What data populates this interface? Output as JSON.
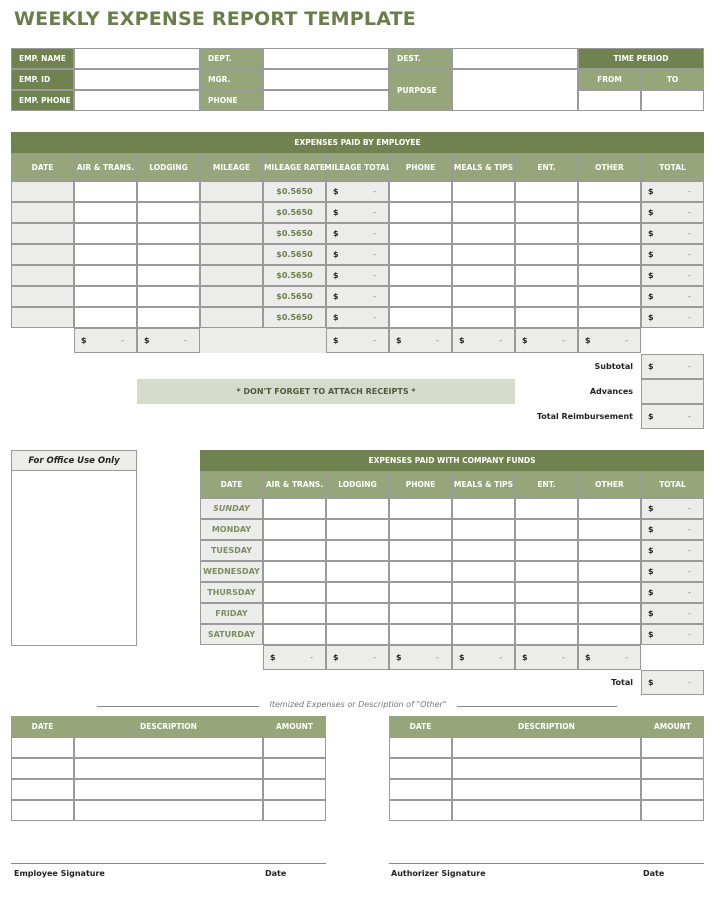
{
  "title": "WEEKLY EXPENSE REPORT TEMPLATE",
  "header": {
    "emp_name_label": "EMP. NAME",
    "emp_id_label": "EMP. ID",
    "emp_phone_label": "EMP. PHONE",
    "dept_label": "DEPT.",
    "mgr_label": "MGR.",
    "phone_label": "PHONE",
    "dest_label": "DEST.",
    "purpose_label": "PURPOSE",
    "time_period_label": "TIME PERIOD",
    "from_label": "FROM",
    "to_label": "TO",
    "emp_name": "",
    "emp_id": "",
    "emp_phone": "",
    "dept": "",
    "mgr": "",
    "phone": "",
    "dest": "",
    "purpose": "",
    "from": "",
    "to": ""
  },
  "employee_expenses": {
    "title": "EXPENSES PAID BY EMPLOYEE",
    "columns": [
      "DATE",
      "AIR & TRANS.",
      "LODGING",
      "MILEAGE",
      "MILEAGE RATE",
      "MILEAGE TOTAL",
      "PHONE",
      "MEALS & TIPS",
      "ENT.",
      "OTHER",
      "TOTAL"
    ],
    "rows": [
      {
        "mileage_rate": "$0.5650",
        "mileage_total": {
          "cur": "$",
          "val": "-"
        },
        "total": {
          "cur": "$",
          "val": "-"
        }
      },
      {
        "mileage_rate": "$0.5650",
        "mileage_total": {
          "cur": "$",
          "val": "-"
        },
        "total": {
          "cur": "$",
          "val": "-"
        }
      },
      {
        "mileage_rate": "$0.5650",
        "mileage_total": {
          "cur": "$",
          "val": "-"
        },
        "total": {
          "cur": "$",
          "val": "-"
        }
      },
      {
        "mileage_rate": "$0.5650",
        "mileage_total": {
          "cur": "$",
          "val": "-"
        },
        "total": {
          "cur": "$",
          "val": "-"
        }
      },
      {
        "mileage_rate": "$0.5650",
        "mileage_total": {
          "cur": "$",
          "val": "-"
        },
        "total": {
          "cur": "$",
          "val": "-"
        }
      },
      {
        "mileage_rate": "$0.5650",
        "mileage_total": {
          "cur": "$",
          "val": "-"
        },
        "total": {
          "cur": "$",
          "val": "-"
        }
      },
      {
        "mileage_rate": "$0.5650",
        "mileage_total": {
          "cur": "$",
          "val": "-"
        },
        "total": {
          "cur": "$",
          "val": "-"
        }
      }
    ],
    "column_totals": {
      "air_trans": {
        "cur": "$",
        "val": "-"
      },
      "lodging": {
        "cur": "$",
        "val": "-"
      },
      "mileage_total": {
        "cur": "$",
        "val": "-"
      },
      "phone": {
        "cur": "$",
        "val": "-"
      },
      "meals_tips": {
        "cur": "$",
        "val": "-"
      },
      "ent": {
        "cur": "$",
        "val": "-"
      },
      "other": {
        "cur": "$",
        "val": "-"
      }
    },
    "receipt_note": "* DON'T FORGET TO ATTACH RECEIPTS *",
    "subtotal_label": "Subtotal",
    "subtotal": {
      "cur": "$",
      "val": "-"
    },
    "advances_label": "Advances",
    "advances": "",
    "total_reimbursement_label": "Total Reimbursement",
    "total_reimbursement": {
      "cur": "$",
      "val": "-"
    }
  },
  "office_use": {
    "label": "For Office Use Only"
  },
  "company_expenses": {
    "title": "EXPENSES PAID WITH COMPANY FUNDS",
    "columns": [
      "DATE",
      "AIR & TRANS.",
      "LODGING",
      "PHONE",
      "MEALS & TIPS",
      "ENT.",
      "OTHER",
      "TOTAL"
    ],
    "days": [
      "SUNDAY",
      "MONDAY",
      "TUESDAY",
      "WEDNESDAY",
      "THURSDAY",
      "FRIDAY",
      "SATURDAY"
    ],
    "row_total": {
      "cur": "$",
      "val": "-"
    },
    "column_total": {
      "cur": "$",
      "val": "-"
    },
    "total_label": "Total",
    "total": {
      "cur": "$",
      "val": "-"
    }
  },
  "itemized": {
    "caption": "Itemized Expenses or Description of \"Other\"",
    "columns": [
      "DATE",
      "DESCRIPTION",
      "AMOUNT"
    ]
  },
  "signatures": {
    "employee_label": "Employee Signature",
    "employee_date_label": "Date",
    "authorizer_label": "Authorizer Signature",
    "authorizer_date_label": "Date"
  }
}
